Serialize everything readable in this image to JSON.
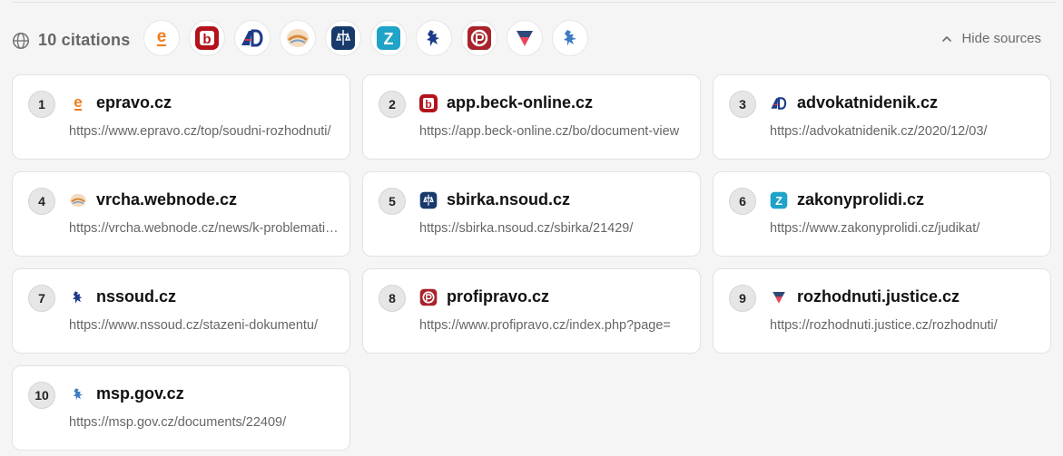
{
  "header": {
    "citations_label": "10 citations",
    "hide_label": "Hide sources"
  },
  "favicons": [
    "epravo",
    "beck",
    "advokatnidenik",
    "vrcha",
    "nsoud-sbirka",
    "zakonyprolidi",
    "nssoud",
    "profipravo",
    "justice",
    "msp"
  ],
  "sources": [
    {
      "num": "1",
      "domain": "epravo.cz",
      "url": "https://www.epravo.cz/top/soudni-rozhodnuti/",
      "icon": "epravo-icon"
    },
    {
      "num": "2",
      "domain": "app.beck-online.cz",
      "url": "https://app.beck-online.cz/bo/document-view",
      "icon": "beck-icon"
    },
    {
      "num": "3",
      "domain": "advokatnidenik.cz",
      "url": "https://advokatnidenik.cz/2020/12/03/",
      "icon": "advokatnidenik-icon"
    },
    {
      "num": "4",
      "domain": "vrcha.webnode.cz",
      "url": "https://vrcha.webnode.cz/news/k-problematice/",
      "icon": "vrcha-icon"
    },
    {
      "num": "5",
      "domain": "sbirka.nsoud.cz",
      "url": "https://sbirka.nsoud.cz/sbirka/21429/",
      "icon": "nsoud-icon"
    },
    {
      "num": "6",
      "domain": "zakonyprolidi.cz",
      "url": "https://www.zakonyprolidi.cz/judikat/",
      "icon": "zakonyprolidi-icon"
    },
    {
      "num": "7",
      "domain": "nssoud.cz",
      "url": "https://www.nssoud.cz/stazeni-dokumentu/",
      "icon": "nssoud-icon"
    },
    {
      "num": "8",
      "domain": "profipravo.cz",
      "url": "https://www.profipravo.cz/index.php?page=",
      "icon": "profipravo-icon"
    },
    {
      "num": "9",
      "domain": "rozhodnuti.justice.cz",
      "url": "https://rozhodnuti.justice.cz/rozhodnuti/",
      "icon": "justice-icon"
    },
    {
      "num": "10",
      "domain": "msp.gov.cz",
      "url": "https://msp.gov.cz/documents/22409/",
      "icon": "msp-icon"
    }
  ]
}
